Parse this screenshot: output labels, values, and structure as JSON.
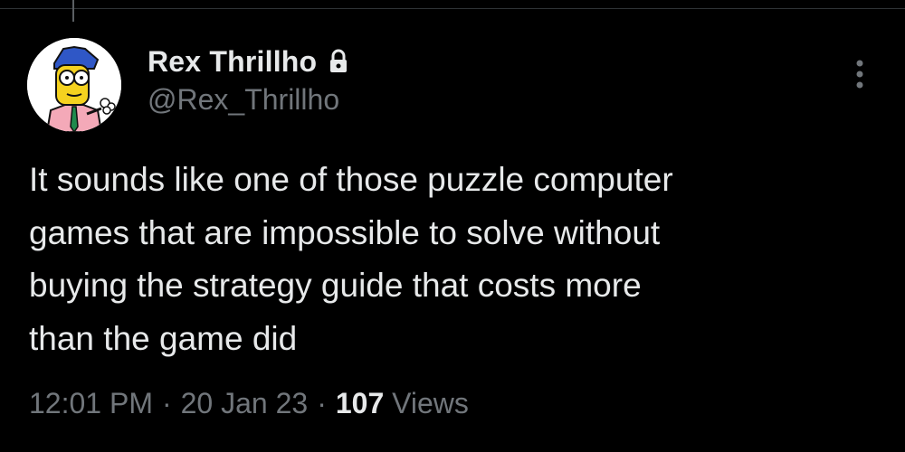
{
  "author": {
    "display_name": "Rex Thrillho",
    "handle": "@Rex_Thrillho",
    "protected_icon": "lock-icon",
    "avatar_icon": "cartoon-avatar"
  },
  "tweet": {
    "text": "It sounds like one of those puzzle computer\ngames that are impossible to solve without\nbuying the strategy guide that costs more\nthan the game did",
    "time": "12:01 PM",
    "date": "20 Jan 23",
    "separator": "·",
    "views_count": "107",
    "views_label": "Views"
  },
  "actions": {
    "more_icon": "more-vertical-icon"
  },
  "colors": {
    "background": "#000000",
    "primary_text": "#e7e9ea",
    "secondary_text": "#71767b",
    "divider": "#2f3336"
  }
}
